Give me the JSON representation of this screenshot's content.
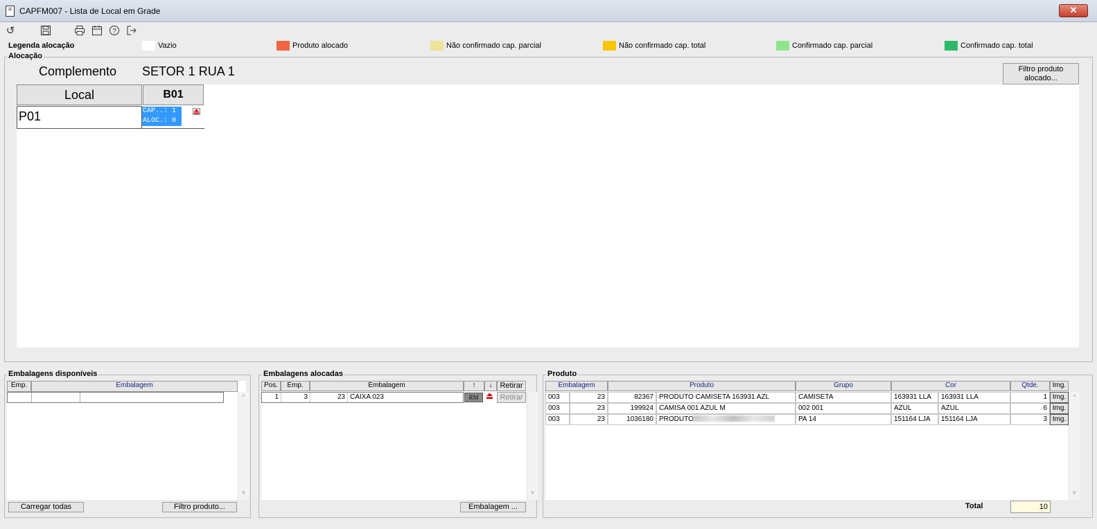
{
  "window": {
    "title": "CAPFM007 - Lista de Local em Grade",
    "close_label": "✕"
  },
  "toolbar": [
    {
      "name": "refresh-icon",
      "glyph": "↺"
    },
    {
      "name": "save-icon",
      "glyph": "🖫"
    },
    {
      "name": "print-icon",
      "glyph": "⎙"
    },
    {
      "name": "calendar-icon",
      "glyph": "▦"
    },
    {
      "name": "help-icon",
      "glyph": "?"
    },
    {
      "name": "exit-icon",
      "glyph": "⇥"
    }
  ],
  "legend": {
    "label": "Legenda alocação",
    "items": [
      {
        "label": "Vazio",
        "color": "#ffffff"
      },
      {
        "label": "Produto alocado",
        "color": "#f06544"
      },
      {
        "label": "Não confirmado cap. parcial",
        "color": "#ede39a"
      },
      {
        "label": "Não confirmado cap. total",
        "color": "#f7c600"
      },
      {
        "label": "Confirmado cap. parcial",
        "color": "#8fe58c"
      },
      {
        "label": "Confirmado cap. total",
        "color": "#2eb86a"
      }
    ]
  },
  "alocacao": {
    "label": "Alocação",
    "complemento_label": "Complemento",
    "complemento_value": "SETOR 1 RUA 1",
    "filter_button": "Filtro produto alocado...",
    "local_header": "Local",
    "column_header": "B01",
    "row_label": "P01",
    "cell_cap": "CAP..: 1",
    "cell_aloc": "ALOC.: 0",
    "highlight_color": "#3399ff"
  },
  "disponiveis": {
    "label": "Embalagens disponíveis",
    "headers": [
      "Emp.",
      "Embalagem"
    ],
    "load_all_button": "Carregar todas",
    "filter_button": "Filtro produto..."
  },
  "alocadas": {
    "label": "Embalagens alocadas",
    "headers": [
      "Pos.",
      "Emp.",
      "Embalagem",
      "↑",
      "↓",
      "Retirar"
    ],
    "rows": [
      {
        "pos": "1",
        "emp": "3",
        "num": "23",
        "desc": "CAIXA 023",
        "rm": "RM",
        "retirar": "Retirar"
      }
    ],
    "embalagem_button": "Embalagem ..."
  },
  "produto": {
    "label": "Produto",
    "headers": [
      "Embalagem",
      "Produto",
      "Grupo",
      "Cor",
      "Qtde.",
      "Img."
    ],
    "rows": [
      {
        "emb1": "003",
        "emb2": "23",
        "cod": "82367",
        "desc": "PRODUTO CAMISETA 163931 AZL",
        "grupo": "CAMISETA",
        "cor1": "163931 LLA",
        "cor2": "163931 LLA",
        "qtde": "1",
        "img": "Img."
      },
      {
        "emb1": "003",
        "emb2": "23",
        "cod": "199924",
        "desc": "CAMISA 001 AZUL M",
        "grupo": "002 001",
        "cor1": "AZUL",
        "cor2": "AZUL",
        "qtde": "6",
        "img": "Img."
      },
      {
        "emb1": "003",
        "emb2": "23",
        "cod": "1036180",
        "desc": "PRODUTO",
        "grupo": "PA 14",
        "cor1": "151164 LJA",
        "cor2": "151164 LJA",
        "qtde": "3",
        "img": "Img."
      }
    ],
    "total_label": "Total",
    "total_value": "10"
  }
}
